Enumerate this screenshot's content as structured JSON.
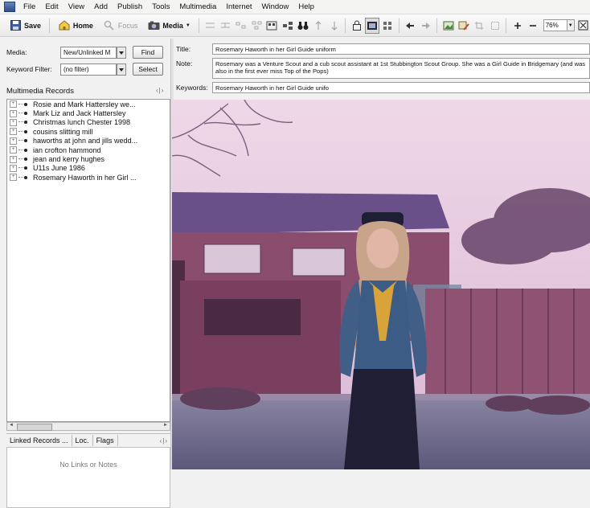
{
  "menu": [
    "File",
    "Edit",
    "View",
    "Add",
    "Publish",
    "Tools",
    "Multimedia",
    "Internet",
    "Window",
    "Help"
  ],
  "toolbar": {
    "save_label": "Save",
    "home_label": "Home",
    "focus_label": "Focus",
    "media_label": "Media",
    "zoom_value": "76%"
  },
  "left": {
    "media_label": "Media:",
    "media_value": "New/Unlinked M",
    "find_label": "Find",
    "keyword_label": "Keyword Filter:",
    "keyword_value": "(no filter)",
    "select_label": "Select",
    "records_header": "Multimedia Records",
    "records": [
      "Rosie and Mark Hattersley we...",
      "Mark Liz and Jack Hattersley",
      "Christmas lunch Chester 1998",
      "cousins slitting mill",
      "haworths at john and jills wedd...",
      "ian crofton hammond",
      "jean and kerry hughes",
      "U11s June 1986",
      "Rosemary Haworth in her Girl ..."
    ],
    "linked_tabs": [
      "Linked Records ...",
      "Loc.",
      "Flags"
    ],
    "linked_empty": "No Links or Notes"
  },
  "right": {
    "title_label": "Title:",
    "title_value": "Rosemary Haworth in her Girl Guide uniform",
    "note_label": "Note:",
    "note_value": "Rosemary was a Venture Scout and a cub scout assistant at 1st Stubbington Scout Group. She was a Girl Guide in Bridgemary (and was also in the first ever miss Top of the Pops)",
    "keywords_label": "Keywords:",
    "keywords_value": "Rosemary Haworth in her Girl Guide unifo"
  },
  "colors": {
    "accent": "#2f4f8f",
    "sky": "#e7cde1",
    "roof": "#6a5088",
    "brick": "#8a4d6d",
    "lawn": "#6d6a8b"
  },
  "icons": [
    "save-icon",
    "home-icon",
    "focus-icon",
    "media-icon",
    "binoculars-icon",
    "lock-icon",
    "zoom-in-icon",
    "zoom-out-icon"
  ]
}
